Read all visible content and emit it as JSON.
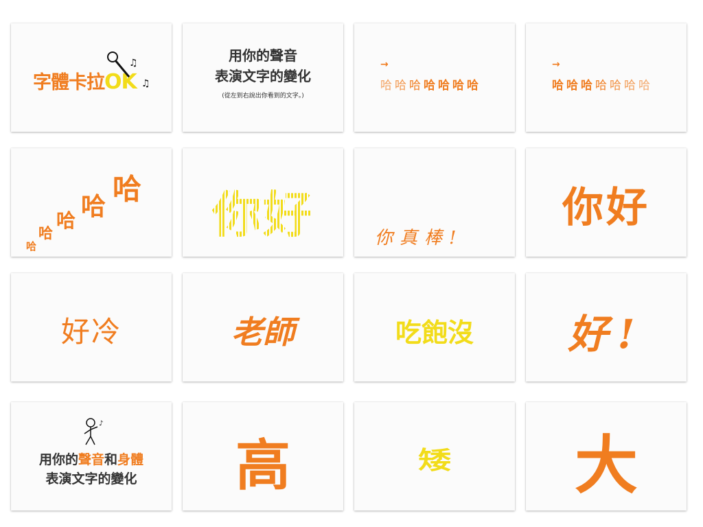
{
  "colors": {
    "orange": "#f07d20",
    "yellow": "#f2dc1a",
    "text_dark": "#333333"
  },
  "slides": [
    {
      "text_main": "字體卡拉",
      "text_ok": "OK",
      "icon": "microphone-icon"
    },
    {
      "line1": "用你的聲音",
      "line2": "表演文字的變化",
      "note": "(從左到右說出你看到的文字。)"
    },
    {
      "arrow": "→",
      "chars": [
        "哈",
        "哈",
        "哈",
        "哈",
        "哈",
        "哈",
        "哈"
      ]
    },
    {
      "arrow": "→",
      "chars": [
        "哈",
        "哈",
        "哈",
        "哈",
        "哈",
        "哈",
        "哈"
      ]
    },
    {
      "chars": [
        "哈",
        "哈",
        "哈",
        "哈",
        "哈"
      ]
    },
    {
      "text": "你好"
    },
    {
      "text": "你真棒!"
    },
    {
      "text": "你好"
    },
    {
      "text": "好冷"
    },
    {
      "text": "老師"
    },
    {
      "text": "吃飽沒"
    },
    {
      "text": "好!"
    },
    {
      "part1": "用你的",
      "part2": "聲音",
      "part3": "和",
      "part4": "身體",
      "line2": "表演文字的變化",
      "icon": "stick-figure-icon"
    },
    {
      "text": "高"
    },
    {
      "text": "矮"
    },
    {
      "text": "大"
    }
  ]
}
